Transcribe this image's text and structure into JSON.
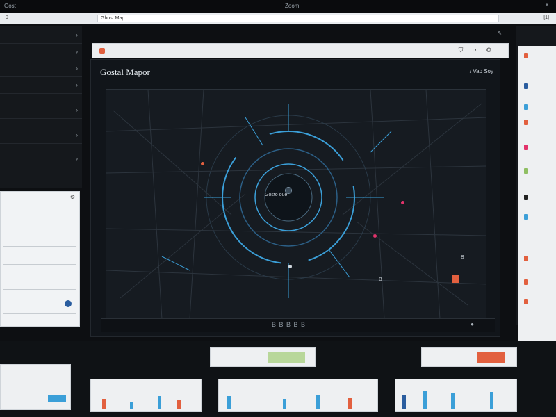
{
  "colors": {
    "accent": "#3b9fd8",
    "orange": "#e2603f",
    "pink": "#e2336b",
    "green": "#8fbf63",
    "dark": "#11151a"
  },
  "titlebar": {
    "left": "Gost",
    "center": "Zoom"
  },
  "addrbar": {
    "left": "9",
    "value": "Ghost Map",
    "right": "[1]"
  },
  "main": {
    "map_title": "Gostal Mapor",
    "map_subtitle": "/ Vap Soy",
    "center_label": "Gosto oue",
    "bottom_label": "B B B B B",
    "tag_c": "B",
    "tag_b": "B",
    "tag_d": "8"
  }
}
